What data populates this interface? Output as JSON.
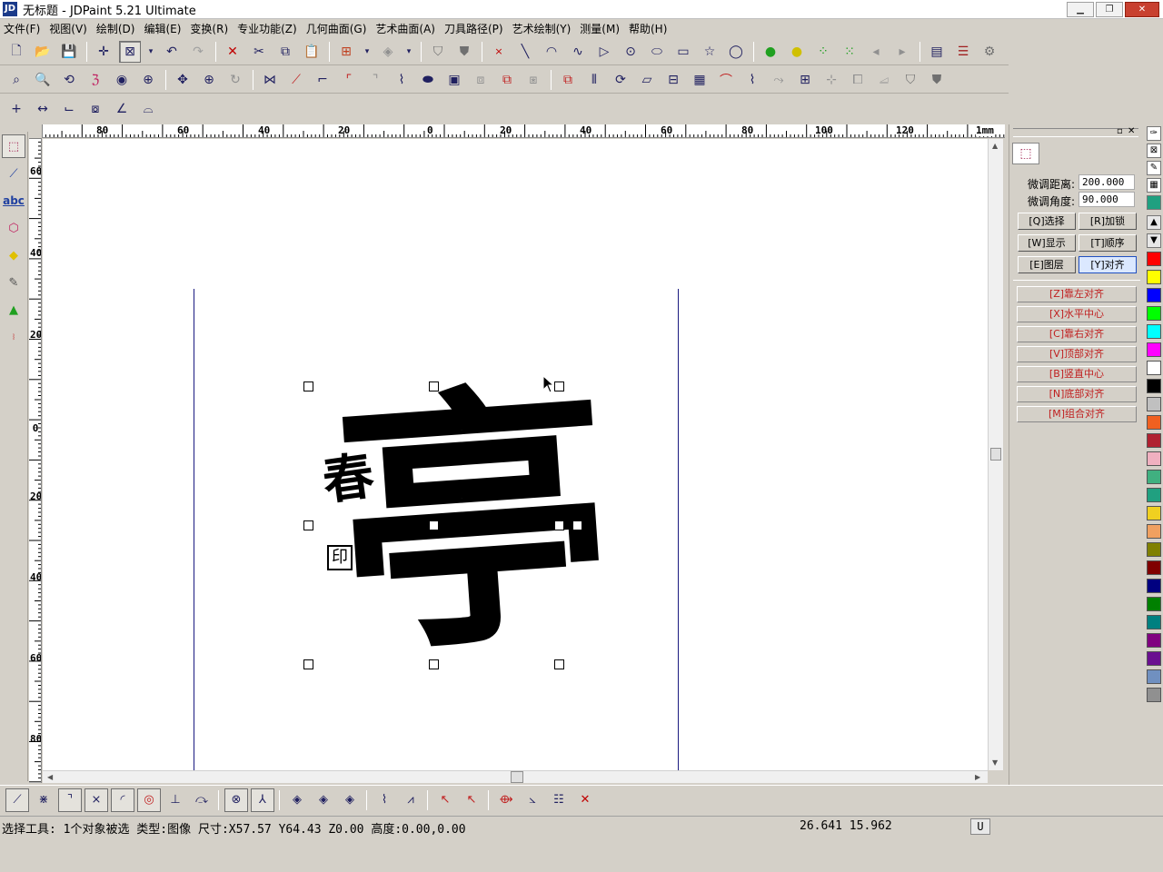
{
  "window": {
    "title": "无标题 - JDPaint 5.21 Ultimate",
    "app_icon": "JD"
  },
  "menu": [
    "文件(F)",
    "视图(V)",
    "绘制(D)",
    "编辑(E)",
    "变换(R)",
    "专业功能(Z)",
    "几何曲面(G)",
    "艺术曲面(A)",
    "刀具路径(P)",
    "艺术绘制(Y)",
    "测量(M)",
    "帮助(H)"
  ],
  "ruler": {
    "unit": "1mm",
    "top_labels": [
      "80",
      "60",
      "40",
      "20",
      "0",
      "20",
      "40",
      "60",
      "80",
      "100",
      "120"
    ],
    "left_labels": [
      "60",
      "40",
      "20",
      "0",
      "20",
      "40",
      "60",
      "80"
    ]
  },
  "canvas": {
    "calligraphy_main": "亭",
    "calligraphy_small": "春",
    "seal": "印"
  },
  "right_panel": {
    "fine_distance_label": "微调距离:",
    "fine_distance_value": "200.000",
    "fine_angle_label": "微调角度:",
    "fine_angle_value": "90.000",
    "buttons": [
      "[Q]选择",
      "[R]加锁",
      "[W]显示",
      "[T]顺序",
      "[E]图层",
      "[Y]对齐"
    ],
    "align_buttons": [
      "[Z]靠左对齐",
      "[X]水平中心",
      "[C]靠右对齐",
      "[V]顶部对齐",
      "[B]竖直中心",
      "[N]底部对齐",
      "[M]组合对齐"
    ]
  },
  "palette": {
    "colors": [
      "#ff0000",
      "#ffff00",
      "#0000ff",
      "#00ff00",
      "#00ffff",
      "#ff00ff",
      "#ffffff",
      "#000000",
      "#c0c0c0",
      "#f06020",
      "#b02030",
      "#f0b0c0",
      "#40b080",
      "#20a080",
      "#f0d020",
      "#f0a060",
      "#808000",
      "#800000",
      "#000080",
      "#008000",
      "#008080",
      "#800080",
      "#6a1090",
      "#7090c0",
      "#909090"
    ]
  },
  "status": {
    "text": "选择工具: 1个对象被选 类型:图像 尺寸:X57.57 Y64.43 Z0.00 高度:0.00,0.00",
    "coords": "26.641  15.962",
    "mode": "U"
  }
}
